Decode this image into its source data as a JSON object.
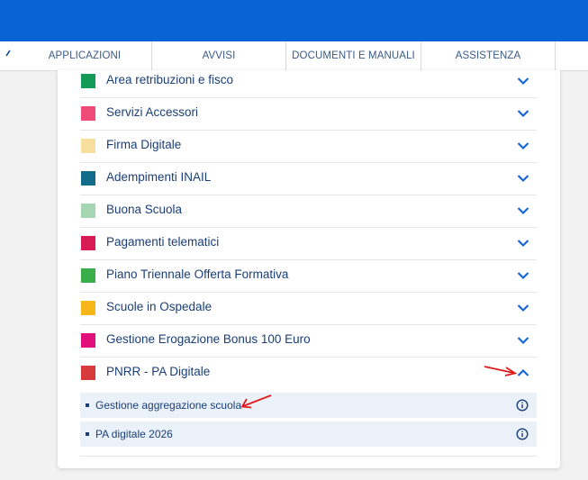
{
  "nav": {
    "tabs": [
      {
        "label": "APPLICAZIONI"
      },
      {
        "label": "AVVISI"
      },
      {
        "label": "DOCUMENTI E MANUALI"
      },
      {
        "label": "ASSISTENZA"
      }
    ]
  },
  "categories": [
    {
      "label": "Area retribuzioni e fisco",
      "color": "#159a58"
    },
    {
      "label": "Servizi Accessori",
      "color": "#ef4a78"
    },
    {
      "label": "Firma Digitale",
      "color": "#f8dfa0"
    },
    {
      "label": "Adempimenti INAIL",
      "color": "#136b8c"
    },
    {
      "label": "Buona Scuola",
      "color": "#a6d5b2"
    },
    {
      "label": "Pagamenti telematici",
      "color": "#d81b55"
    },
    {
      "label": "Piano Triennale Offerta Formativa",
      "color": "#3aae48"
    },
    {
      "label": "Scuole in Ospedale",
      "color": "#f6b71a"
    },
    {
      "label": "Gestione Erogazione Bonus 100 Euro",
      "color": "#e2107a"
    },
    {
      "label": "PNRR - PA Digitale",
      "color": "#d63a3a",
      "expanded": true
    }
  ],
  "subitems": [
    {
      "label": "Gestione aggregazione scuola"
    },
    {
      "label": "PA digitale 2026"
    }
  ],
  "colors": {
    "topbar": "#0a63d4",
    "accent": "#1a66d6",
    "annotation": "#e01b1b"
  }
}
